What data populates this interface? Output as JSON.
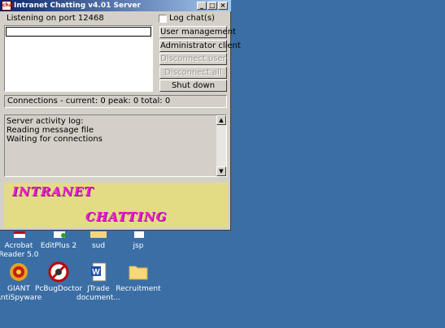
{
  "window": {
    "title": "Intranet Chatting v4.01 Server",
    "icon_text": "chat",
    "controls": {
      "minimize": "_",
      "maximize": "□",
      "close": "×"
    }
  },
  "server": {
    "listening_label": "Listening on port 12468",
    "log_chats_label": "Log chat(s)",
    "log_chats_checked": false,
    "port_field_value": ""
  },
  "buttons": {
    "user_management": "User management",
    "administrator_client": "Administrator client",
    "disconnect_user": "Disconnect user",
    "disconnect_all": "Disconnect all",
    "shut_down": "Shut down"
  },
  "connections": {
    "status_text": "Connections - current: 0  peak: 0  total: 0"
  },
  "activity_log": {
    "lines": [
      "Server activity log:",
      "Reading message file",
      "Waiting for connections"
    ]
  },
  "banner": {
    "word1": "INTRANET",
    "word2": "CHATTING"
  },
  "desktop": {
    "row1": [
      {
        "label": "Acrobat\nReader 5.0",
        "icon": "acrobat-icon"
      },
      {
        "label": "EditPlus 2",
        "icon": "editplus-icon"
      },
      {
        "label": "sud",
        "icon": "folder-icon"
      },
      {
        "label": "jsp",
        "icon": "folder-icon"
      }
    ],
    "row2": [
      {
        "label": "GIANT\nAntiSpyware",
        "icon": "giant-antispyware-icon"
      },
      {
        "label": "PcBugDoctor",
        "icon": "pcbugdoctor-icon"
      },
      {
        "label": "JTrade\ndocument...",
        "icon": "word-document-icon"
      },
      {
        "label": "Recruitment",
        "icon": "folder-icon"
      }
    ]
  }
}
